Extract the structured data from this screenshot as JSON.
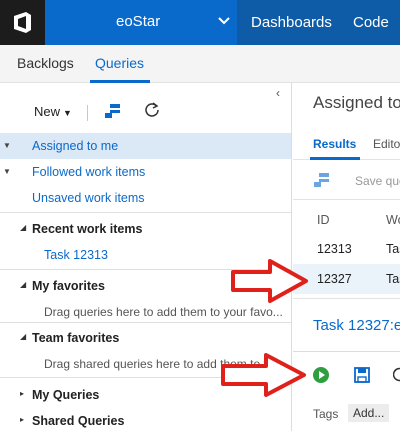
{
  "header": {
    "project_name": "eoStar",
    "nav": {
      "dashboards": "Dashboards",
      "code": "Code"
    },
    "colors": {
      "brand": "#0a6acb",
      "logo_bg": "#1c1c1c"
    }
  },
  "tabs": {
    "backlogs": "Backlogs",
    "queries": "Queries",
    "active": "Queries"
  },
  "left": {
    "toolbar": {
      "new_label": "New"
    },
    "queries": [
      {
        "label": "Assigned to me"
      },
      {
        "label": "Followed work items"
      },
      {
        "label": "Unsaved work items"
      }
    ],
    "recent": {
      "title": "Recent work items",
      "item": "Task 12313"
    },
    "my_favorites": {
      "title": "My favorites",
      "hint": "Drag queries here to add them to your favo..."
    },
    "team_favorites": {
      "title": "Team favorites",
      "hint": "Drag shared queries here to add them to yo..."
    },
    "my_queries": {
      "title": "My Queries"
    },
    "shared_queries": {
      "title": "Shared Queries"
    }
  },
  "right": {
    "title": "Assigned to",
    "tabs": {
      "results": "Results",
      "editor": "Edito"
    },
    "save_label": "Save que",
    "columns": {
      "id": "ID",
      "work": "Wo"
    },
    "rows": [
      {
        "id": "12313",
        "type": "Tas"
      },
      {
        "id": "12327",
        "type": "Tas"
      }
    ],
    "task_header": "Task 12327:e",
    "tags_label": "Tags",
    "add_label": "Add..."
  }
}
